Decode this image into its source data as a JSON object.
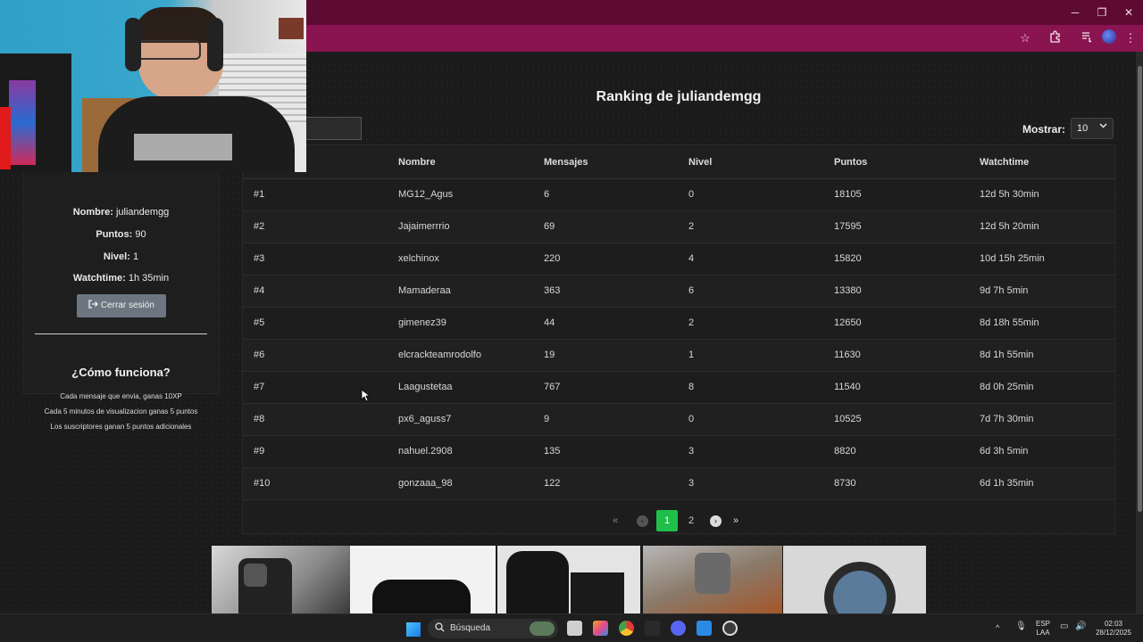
{
  "browser": {
    "window_controls": {
      "minimize": "─",
      "maximize": "❐",
      "close": "✕"
    }
  },
  "page": {
    "title": "Ranking de juliandemgg",
    "show": {
      "label": "Mostrar:",
      "value": "10"
    },
    "columns": [
      "Nombre",
      "Mensajes",
      "Nivel",
      "Puntos",
      "Watchtime"
    ],
    "rows": [
      {
        "rank": "#1",
        "name": "MG12_Agus",
        "messages": "6",
        "level": "0",
        "points": "18105",
        "watchtime": "12d 5h 30min"
      },
      {
        "rank": "#2",
        "name": "Jajaimerrrio",
        "messages": "69",
        "level": "2",
        "points": "17595",
        "watchtime": "12d 5h 20min"
      },
      {
        "rank": "#3",
        "name": "xelchinox",
        "messages": "220",
        "level": "4",
        "points": "15820",
        "watchtime": "10d 15h 25min"
      },
      {
        "rank": "#4",
        "name": "Mamaderaa",
        "messages": "363",
        "level": "6",
        "points": "13380",
        "watchtime": "9d 7h 5min"
      },
      {
        "rank": "#5",
        "name": "gimenez39",
        "messages": "44",
        "level": "2",
        "points": "12650",
        "watchtime": "8d 18h 55min"
      },
      {
        "rank": "#6",
        "name": "elcrackteamrodolfo",
        "messages": "19",
        "level": "1",
        "points": "11630",
        "watchtime": "8d 1h 55min"
      },
      {
        "rank": "#7",
        "name": "Laagustetaa",
        "messages": "767",
        "level": "8",
        "points": "11540",
        "watchtime": "8d 0h 25min"
      },
      {
        "rank": "#8",
        "name": "px6_aguss7",
        "messages": "9",
        "level": "0",
        "points": "10525",
        "watchtime": "7d 7h 30min"
      },
      {
        "rank": "#9",
        "name": "nahuel.2908",
        "messages": "135",
        "level": "3",
        "points": "8820",
        "watchtime": "6d 3h 5min"
      },
      {
        "rank": "#10",
        "name": "gonzaaa_98",
        "messages": "122",
        "level": "3",
        "points": "8730",
        "watchtime": "6d 1h 35min"
      }
    ],
    "pagination": {
      "first": "«",
      "prev": "‹",
      "pages": [
        "1",
        "2"
      ],
      "current": "1",
      "next": "›",
      "last": "»"
    }
  },
  "profile": {
    "name_label": "Nombre:",
    "name": "juliandemgg",
    "points_label": "Puntos:",
    "points": "90",
    "level_label": "Nivel:",
    "level": "1",
    "watchtime_label": "Watchtime:",
    "watchtime": "1h 35min",
    "logout": "Cerrar sesión",
    "how_title": "¿Cómo funciona?",
    "rules": [
      "Cada mensaje que envia, ganas 10XP",
      "Cada 5 minutos de visualizacion ganas 5 puntos",
      "Los suscriptores ganan 5 puntos adicionales"
    ]
  },
  "taskbar": {
    "search_placeholder": "Búsqueda",
    "lang": "ESP",
    "layout": "LAA",
    "time": "02:03",
    "date": "28/12/2025"
  },
  "colors": {
    "titlebar": "#5e0b34",
    "toolbar": "#8a1450",
    "active_page": "#1fbf4a",
    "page_bg": "#1b1b1b"
  }
}
